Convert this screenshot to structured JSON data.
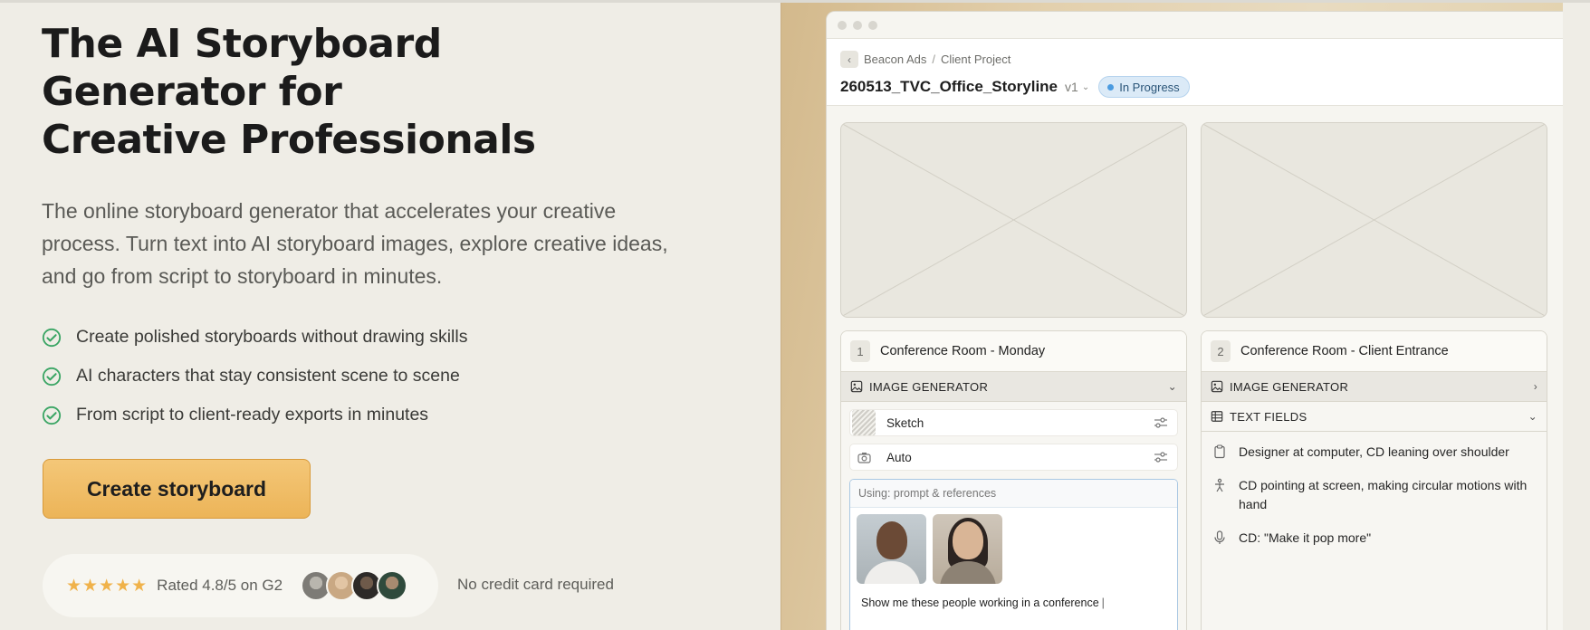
{
  "hero": {
    "title_line1": "The AI Storyboard",
    "title_line2": "Generator for",
    "title_line3": "Creative Professionals",
    "subtitle": "The online storyboard generator that accelerates your creative process. Turn text into AI storyboard images, explore creative ideas, and go from script to storyboard in minutes.",
    "features": [
      "Create polished storyboards without drawing skills",
      "AI characters that stay consistent scene to scene",
      "From script to client-ready exports in minutes"
    ],
    "cta_label": "Create storyboard",
    "stars": "★★★★★",
    "rating_text": "Rated 4.8/5 on G2",
    "no_credit": "No credit card required"
  },
  "app": {
    "breadcrumb": [
      "Beacon Ads",
      "/",
      "Client Project"
    ],
    "project_title": "260513_TVC_Office_Storyline",
    "version": "v1",
    "status": "In Progress",
    "shots": [
      {
        "number": "1",
        "title": "Conference Room - Monday",
        "section": "IMAGE GENERATOR",
        "style": "Sketch",
        "camera": "Auto",
        "prompt_using": "Using: prompt & references",
        "prompt_text": "Show me these people working in a conference"
      },
      {
        "number": "2",
        "title": "Conference Room - Client Entrance",
        "section": "IMAGE GENERATOR",
        "section2": "TEXT FIELDS",
        "text_fields": [
          "Designer at computer, CD leaning over shoulder",
          "CD pointing at screen, making circular motions with hand",
          "CD: \"Make it pop more\""
        ]
      }
    ]
  },
  "colors": {
    "accent_cta": "#ecb458",
    "check_green": "#3aa564",
    "status_blue": "#4b9be0",
    "star_gold": "#f0b24a"
  },
  "icons": [
    "check-circle-icon",
    "chevron-left-icon",
    "chevron-down-icon",
    "chevron-right-icon",
    "image-icon",
    "camera-icon",
    "sliders-icon",
    "table-icon",
    "clipboard-icon",
    "person-icon",
    "microphone-icon"
  ]
}
